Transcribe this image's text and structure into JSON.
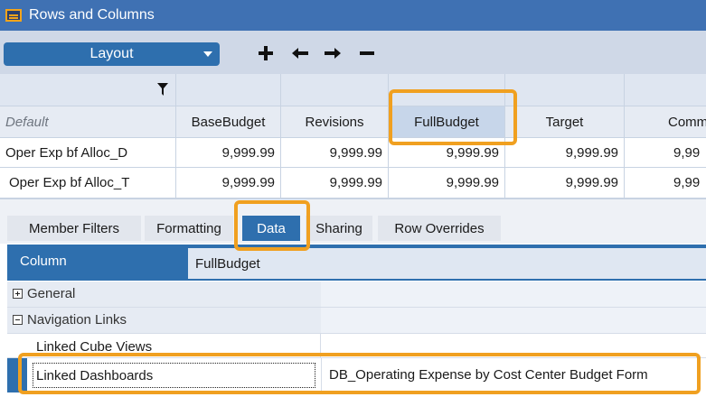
{
  "window": {
    "title": "Rows and Columns"
  },
  "toolbar": {
    "layout_label": "Layout",
    "icons": [
      "plus-icon",
      "arrow-left-icon",
      "arrow-right-icon",
      "minus-icon"
    ]
  },
  "grid": {
    "header_default": "Default",
    "columns": [
      "BaseBudget",
      "Revisions",
      "FullBudget",
      "Target",
      "Commen"
    ],
    "selected_column": "FullBudget",
    "rows": [
      {
        "label": "Oper Exp bf Alloc_D",
        "values": [
          "9,999.99",
          "9,999.99",
          "9,999.99",
          "9,999.99",
          "9,99"
        ]
      },
      {
        "label": "Oper Exp bf Alloc_T",
        "values": [
          "9,999.99",
          "9,999.99",
          "9,999.99",
          "9,999.99",
          "9,99"
        ]
      }
    ]
  },
  "tabs": [
    {
      "label": "Member Filters",
      "active": false
    },
    {
      "label": "Formatting",
      "active": false
    },
    {
      "label": "Data",
      "active": true
    },
    {
      "label": "Sharing",
      "active": false
    },
    {
      "label": "Row Overrides",
      "active": false
    }
  ],
  "properties": {
    "column_header_label": "Column",
    "column_value": "FullBudget",
    "categories": [
      {
        "label": "General",
        "expanded": false
      },
      {
        "label": "Navigation Links",
        "expanded": true
      }
    ],
    "items": [
      {
        "label": "Linked Cube Views",
        "value": ""
      },
      {
        "label": "Linked Dashboards",
        "value": "DB_Operating Expense by Cost Center Budget Form"
      }
    ]
  },
  "colors": {
    "title_bar": "#3f71b3",
    "accent_blue": "#2e6fae",
    "highlight_orange": "#f0a020"
  }
}
